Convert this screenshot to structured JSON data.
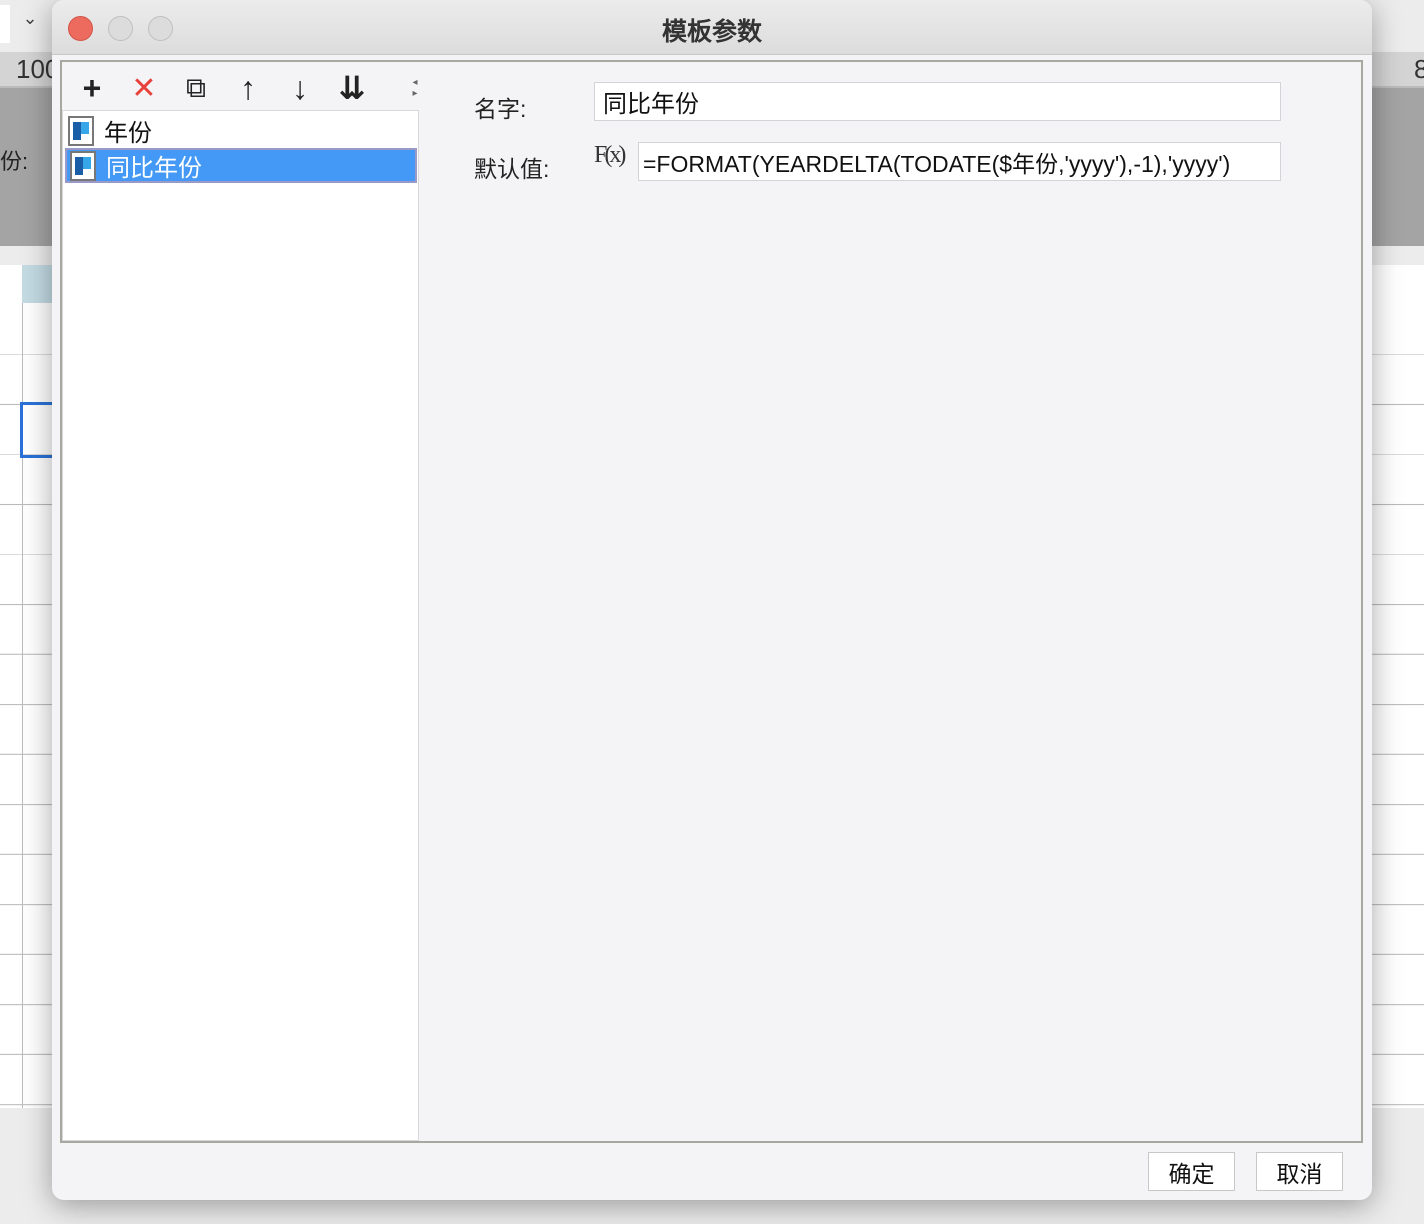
{
  "background": {
    "zoom_text": "100",
    "right_ruler_text": "8",
    "left_label": "份:"
  },
  "dialog": {
    "title": "模板参数",
    "toolbar": {
      "add": "+",
      "delete": "✕",
      "copy": "⧉",
      "up": "↑",
      "down": "↓",
      "sort": "⇊"
    },
    "parameters": [
      {
        "name": "年份",
        "selected": false
      },
      {
        "name": "同比年份",
        "selected": true
      }
    ],
    "form": {
      "name_label": "名字:",
      "name_value": "同比年份",
      "default_label": "默认值:",
      "formula_icon": "F(x)",
      "default_value": "=FORMAT(YEARDELTA(TODATE($年份,'yyyy'),-1),'yyyy')"
    },
    "ok_label": "确定",
    "cancel_label": "取消"
  }
}
